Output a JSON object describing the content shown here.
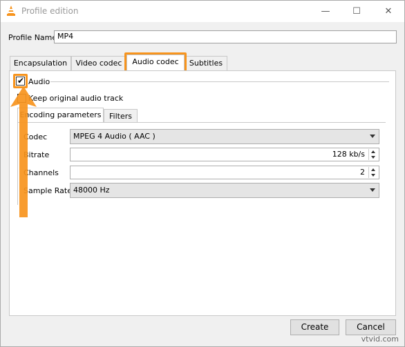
{
  "window": {
    "title": "Profile edition",
    "controls": {
      "minimize": "—",
      "maximize": "☐",
      "close": "✕"
    }
  },
  "profile": {
    "label": "Profile Name",
    "value": "MP4"
  },
  "tabs": [
    {
      "label": "Encapsulation"
    },
    {
      "label": "Video codec"
    },
    {
      "label": "Audio codec"
    },
    {
      "label": "Subtitles"
    }
  ],
  "audio": {
    "enable_label": "Audio",
    "keep_original_label": "Keep original audio track",
    "subtabs": [
      {
        "label": "Encoding parameters"
      },
      {
        "label": "Filters"
      }
    ],
    "fields": {
      "codec": {
        "label": "Codec",
        "value": "MPEG 4 Audio ( AAC )"
      },
      "bitrate": {
        "label": "Bitrate",
        "value": "128 kb/s"
      },
      "channels": {
        "label": "Channels",
        "value": "2"
      },
      "sample_rate": {
        "label": "Sample Rate",
        "value": "48000 Hz"
      }
    }
  },
  "buttons": {
    "create": "Create",
    "cancel": "Cancel"
  },
  "watermark": "vtvid.com",
  "colors": {
    "highlight": "#f7941d",
    "title_text": "#999999"
  },
  "icons": {
    "app": "vlc-cone-icon",
    "checked": "checkmark-icon",
    "arrow": "up-arrow-annotation"
  }
}
